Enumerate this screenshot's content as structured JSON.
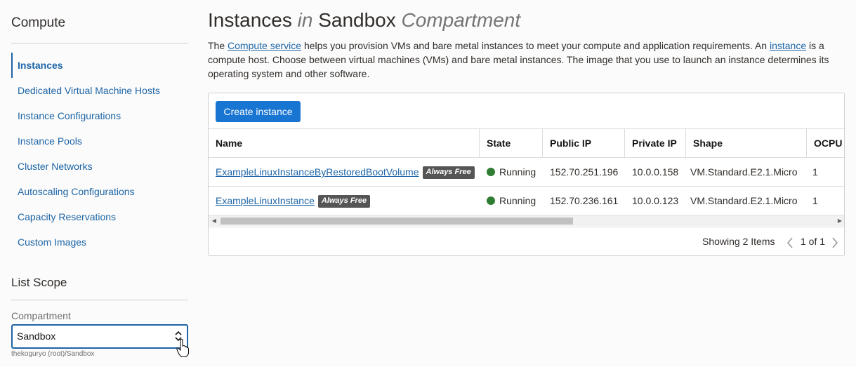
{
  "sidebar": {
    "title": "Compute",
    "items": [
      {
        "label": "Instances",
        "active": true
      },
      {
        "label": "Dedicated Virtual Machine Hosts"
      },
      {
        "label": "Instance Configurations"
      },
      {
        "label": "Instance Pools"
      },
      {
        "label": "Cluster Networks"
      },
      {
        "label": "Autoscaling Configurations"
      },
      {
        "label": "Capacity Reservations"
      },
      {
        "label": "Custom Images"
      }
    ],
    "scope_title": "List Scope",
    "compartment_label": "Compartment",
    "compartment_value": "Sandbox",
    "compartment_path": "thekoguryo (root)/Sandbox"
  },
  "page": {
    "title_main": "Instances",
    "title_in": "in",
    "title_compartment": "Sandbox",
    "title_suffix": "Compartment",
    "intro_1": "The ",
    "intro_link1": "Compute service",
    "intro_2": " helps you provision VMs and bare metal instances to meet your compute and application requirements. An ",
    "intro_link2": "instance",
    "intro_3": " is a compute host. Choose between virtual machines (VMs) and bare metal instances. The image that you use to launch an instance determines its operating system and other software."
  },
  "table": {
    "create_button": "Create instance",
    "columns": [
      "Name",
      "State",
      "Public IP",
      "Private IP",
      "Shape",
      "OCPU"
    ],
    "rows": [
      {
        "name": "ExampleLinuxInstanceByRestoredBootVolume",
        "badge": "Always Free",
        "state": "Running",
        "public_ip": "152.70.251.196",
        "private_ip": "10.0.0.158",
        "shape": "VM.Standard.E2.1.Micro",
        "ocpu": "1"
      },
      {
        "name": "ExampleLinuxInstance",
        "badge": "Always Free",
        "state": "Running",
        "public_ip": "152.70.236.161",
        "private_ip": "10.0.0.123",
        "shape": "VM.Standard.E2.1.Micro",
        "ocpu": "1"
      }
    ],
    "showing": "Showing 2 Items",
    "page_text": "1 of 1",
    "state_color": "#2e7d32"
  },
  "colors": {
    "accent": "#1875d2",
    "link": "#1d65a6",
    "badge": "#555555"
  },
  "icons": [
    "chevron-updown-icon",
    "hand-cursor-icon",
    "scroll-left-icon",
    "scroll-right-icon",
    "chevron-left-icon",
    "chevron-right-icon",
    "status-dot-icon"
  ]
}
